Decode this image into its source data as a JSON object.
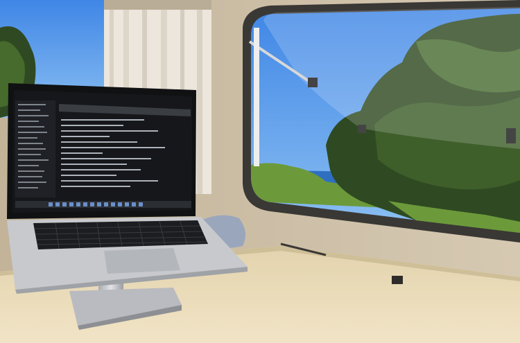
{
  "scene": {
    "subject": "laptop-on-stand-inside-camper-van",
    "colors": {
      "sky": "#4f8fe0",
      "sea": "#2f6fc2",
      "foliage_dark": "#2f4a22",
      "foliage_light": "#6c9a3a",
      "wall": "#cbbda5",
      "table": "#e8d9b5",
      "curtain": "#ece6dc",
      "laptop_body": "#c7c9cd",
      "screen_bg": "#15171a",
      "keyboard": "#1c1d20"
    }
  }
}
